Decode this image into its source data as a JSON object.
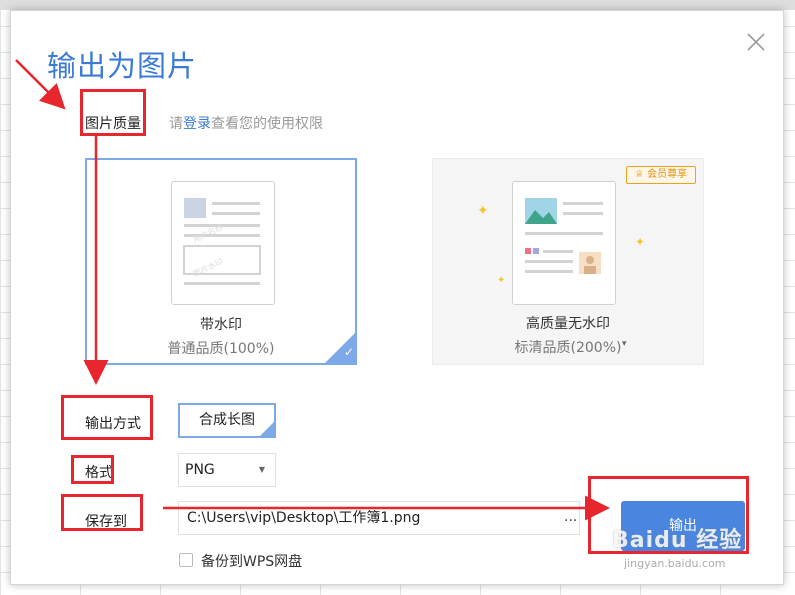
{
  "dialog": {
    "title": "输出为图片",
    "close_icon": "close-icon"
  },
  "quality": {
    "label": "图片质量",
    "hint_prefix": "请",
    "hint_link": "登录",
    "hint_suffix": "查看您的使用权限",
    "options": [
      {
        "name": "带水印",
        "sub": "普通品质(100%)",
        "selected": true
      },
      {
        "name": "高质量无水印",
        "sub": "标清品质(200%)",
        "badge": "会员尊享",
        "selected": false
      }
    ]
  },
  "output_mode": {
    "label": "输出方式",
    "value": "合成长图"
  },
  "format": {
    "label": "格式",
    "value": "PNG"
  },
  "save_to": {
    "label": "保存到",
    "path": "C:\\Users\\vip\\Desktop\\工作簿1.png",
    "browse": "..."
  },
  "backup": {
    "label": "备份到WPS网盘",
    "checked": false
  },
  "export_button": {
    "label": "输出"
  },
  "watermark": {
    "brand": "Baidu 经验",
    "site": "jingyan.baidu.com"
  },
  "colors": {
    "accent": "#3b7bd6",
    "annotation": "#e8262d",
    "badge": "#e39012"
  }
}
